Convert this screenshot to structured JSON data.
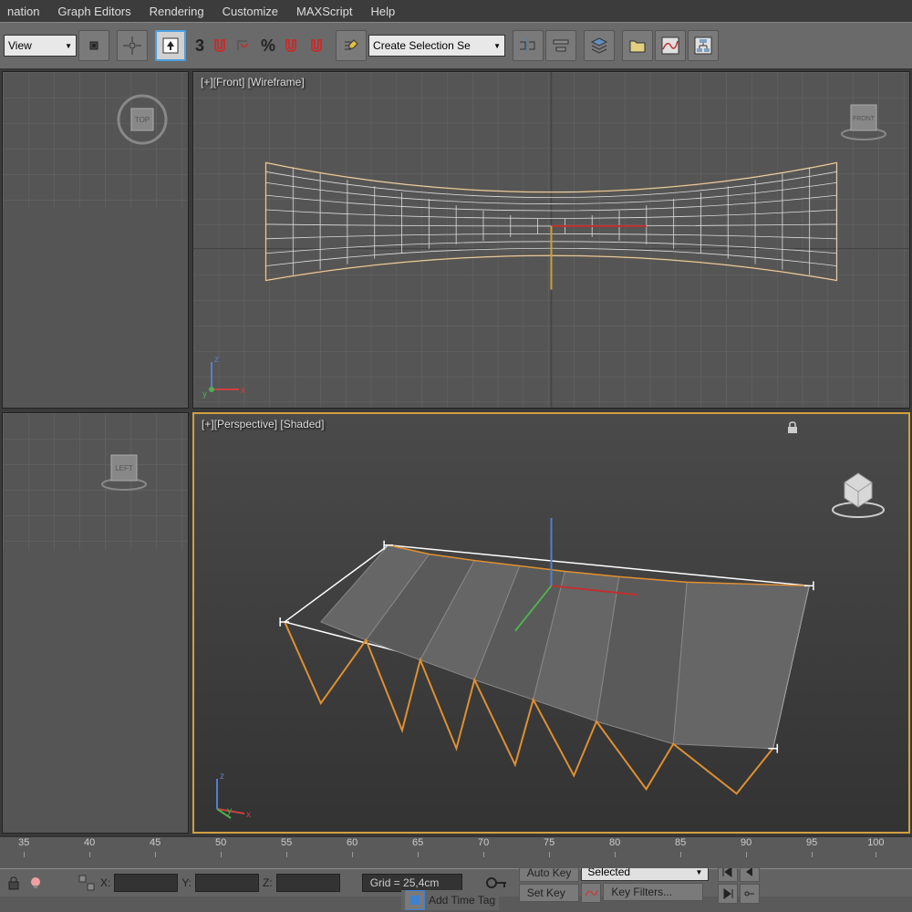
{
  "menu": {
    "items": [
      "nation",
      "Graph Editors",
      "Rendering",
      "Customize",
      "MAXScript",
      "Help"
    ]
  },
  "toolbar": {
    "view_dropdown": "View",
    "spinner": "3",
    "percent": "%",
    "selection_dropdown": "Create Selection Se"
  },
  "viewports": {
    "top_left": {
      "label": "",
      "cube": "TOP"
    },
    "top_right": {
      "label": "[+][Front] [Wireframe]",
      "cube": "FRONT"
    },
    "bottom_left": {
      "label": "",
      "cube": "LEFT"
    },
    "bottom_right": {
      "label": "[+][Perspective] [Shaded]",
      "cube": ""
    }
  },
  "timeline": {
    "ticks": [
      "35",
      "40",
      "45",
      "50",
      "55",
      "60",
      "65",
      "70",
      "75",
      "80",
      "85",
      "90",
      "95",
      "100"
    ]
  },
  "status": {
    "x_label": "X:",
    "x_value": "",
    "y_label": "Y:",
    "y_value": "",
    "z_label": "Z:",
    "z_value": "",
    "grid": "Grid = 25,4cm",
    "add_time_tag": "Add Time Tag",
    "auto_key": "Auto Key",
    "set_key": "Set Key",
    "key_mode": "Selected",
    "key_filters": "Key Filters..."
  },
  "axes": {
    "x": "x",
    "y": "y",
    "z": "z"
  }
}
